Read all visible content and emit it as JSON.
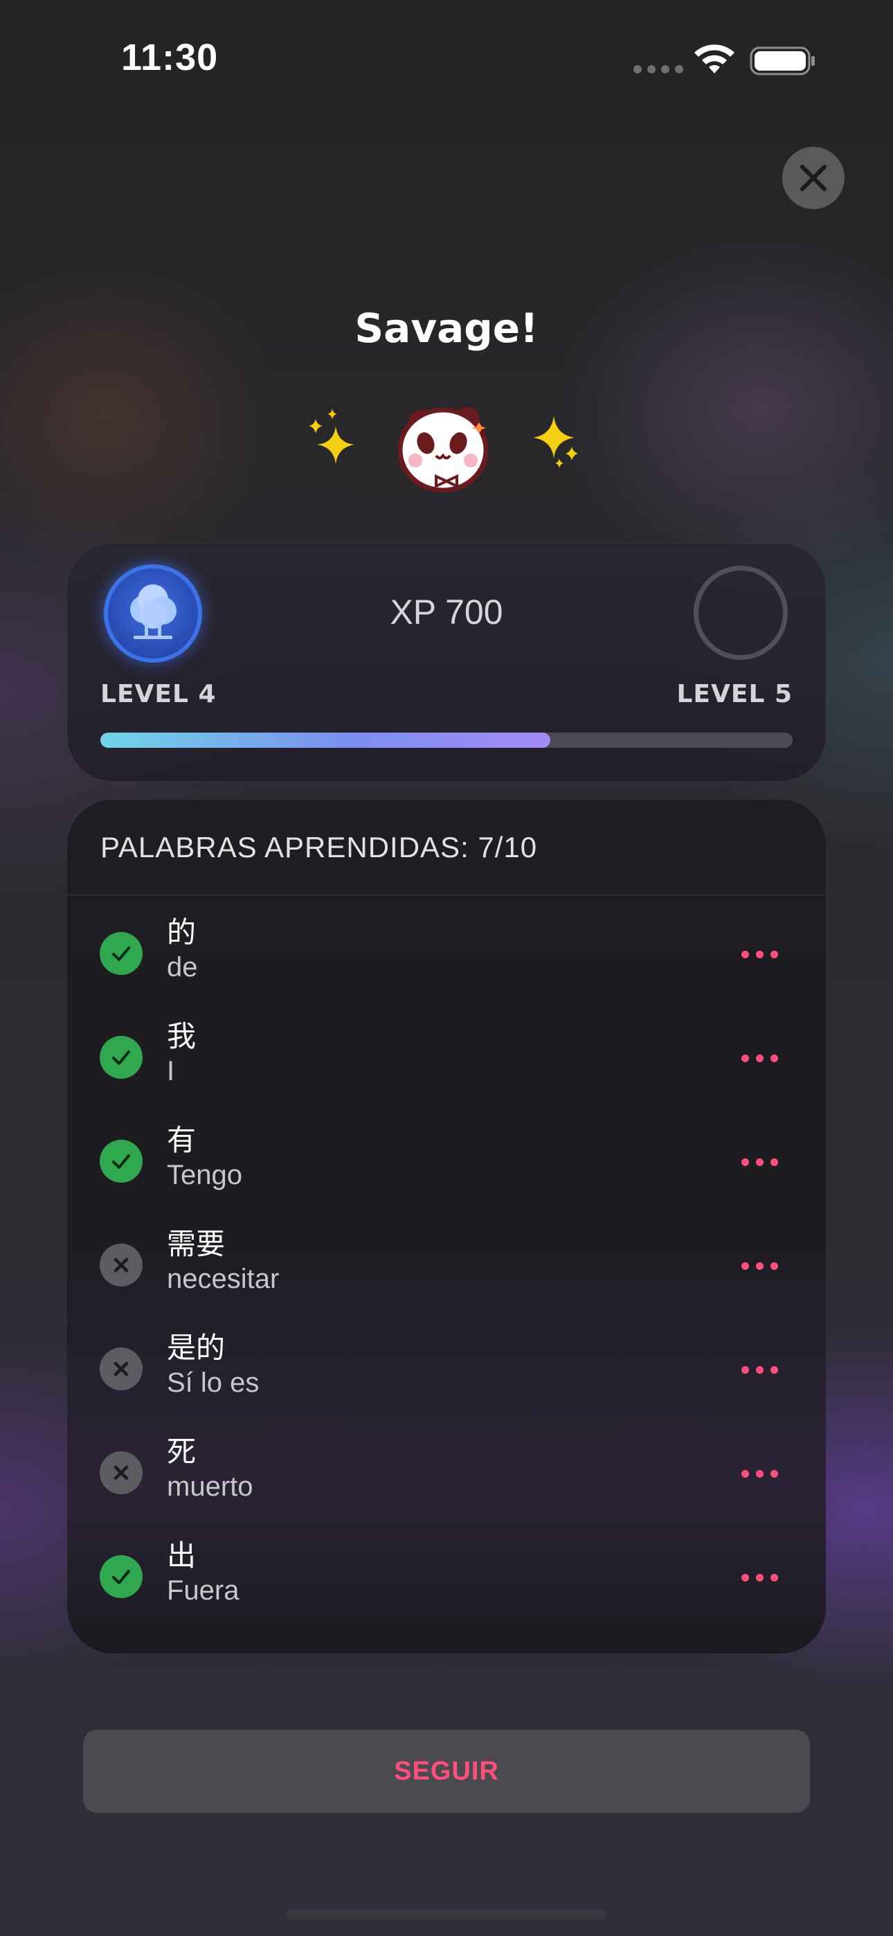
{
  "status_bar": {
    "time": "11:30"
  },
  "header": {
    "title": "Savage!"
  },
  "level_card": {
    "xp_label": "XP 700",
    "current_level_label": "LEVEL 4",
    "next_level_label": "LEVEL 5",
    "progress_fraction": 0.65
  },
  "words": {
    "header": "PALABRAS APRENDIDAS: 7/10",
    "items": [
      {
        "zh": "的",
        "tr": "de",
        "learned": true
      },
      {
        "zh": "我",
        "tr": "I",
        "learned": true
      },
      {
        "zh": "有",
        "tr": "Tengo",
        "learned": true
      },
      {
        "zh": "需要",
        "tr": "necesitar",
        "learned": false
      },
      {
        "zh": "是的",
        "tr": "Sí lo es",
        "learned": false
      },
      {
        "zh": "死",
        "tr": "muerto",
        "learned": false
      },
      {
        "zh": "出",
        "tr": "Fuera",
        "learned": true
      }
    ]
  },
  "actions": {
    "continue_label": "SEGUIR"
  },
  "colors": {
    "accent": "#ff4f7d",
    "success": "#2fa84f",
    "level_badge": "#3d73e8"
  },
  "icons": [
    "wifi-icon",
    "battery-icon",
    "close-icon",
    "sparkle-icon",
    "panda-mascot",
    "tree-icon",
    "check-icon",
    "x-icon",
    "more-icon"
  ]
}
